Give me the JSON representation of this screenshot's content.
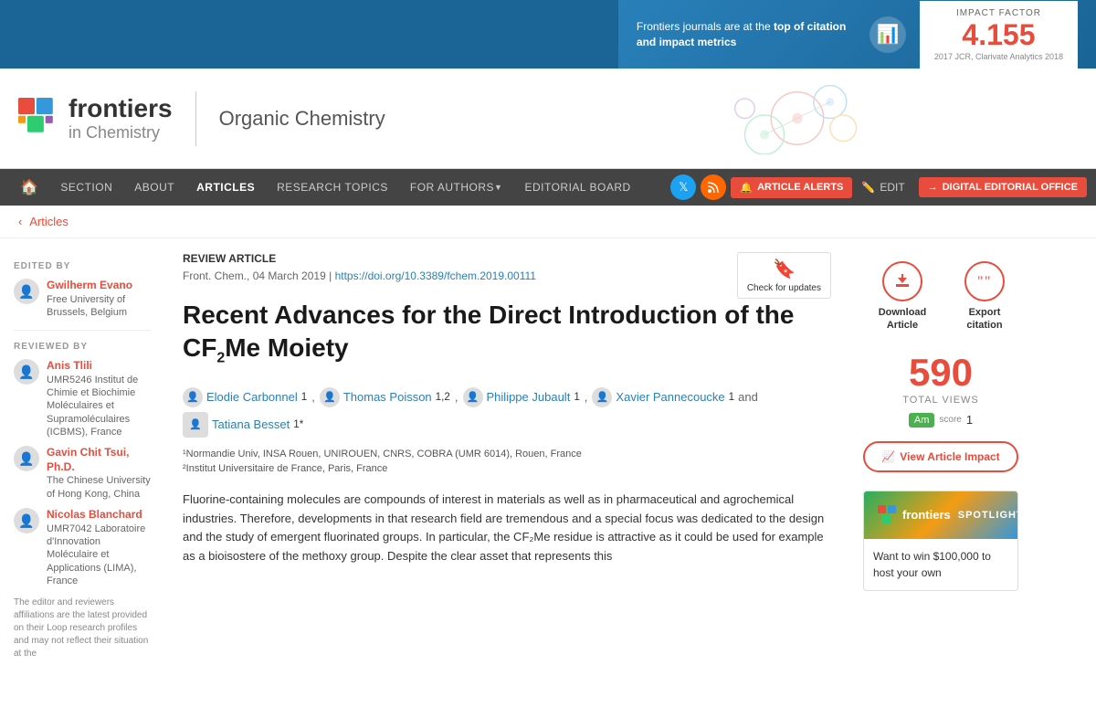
{
  "banner": {
    "text": "Frontiers journals are at the ",
    "text_bold": "top of citation and impact metrics",
    "impact_label": "IMPACT FACTOR",
    "impact_number": "4.155",
    "impact_sub": "2017 JCR, Clarivate Analytics 2018"
  },
  "header": {
    "logo_frontiers": "frontiers",
    "logo_in": "in Chemistry",
    "journal_name": "Organic Chemistry"
  },
  "nav": {
    "items": [
      {
        "label": "SECTION",
        "active": false
      },
      {
        "label": "ABOUT",
        "active": false
      },
      {
        "label": "ARTICLES",
        "active": true
      },
      {
        "label": "RESEARCH TOPICS",
        "active": false
      },
      {
        "label": "FOR AUTHORS",
        "active": false,
        "dropdown": true
      },
      {
        "label": "EDITORIAL BOARD",
        "active": false
      }
    ],
    "alerts_label": "ARTICLE ALERTS",
    "edit_label": "EDIT",
    "digital_label": "DIGITAL EDITORIAL OFFICE"
  },
  "breadcrumb": {
    "back_label": "Articles"
  },
  "left_sidebar": {
    "edited_by_label": "EDITED BY",
    "reviewed_by_label": "REVIEWED BY",
    "editors": [
      {
        "name": "Gwilherm Evano",
        "affiliation": "Free University of Brussels, Belgium"
      }
    ],
    "reviewers": [
      {
        "name": "Anis Tlili",
        "affiliation": "UMR5246 Institut de Chimie et Biochimie Moléculaires et Supramoléculaires (ICBMS), France"
      },
      {
        "name": "Gavin Chit Tsui, Ph.D.",
        "affiliation": "The Chinese University of Hong Kong, China"
      },
      {
        "name": "Nicolas Blanchard",
        "affiliation": "UMR7042 Laboratoire d'Innovation Moléculaire et Applications (LIMA), France"
      }
    ],
    "disclaimer": "The editor and reviewers affiliations are the latest provided on their Loop research profiles and may not reflect their situation at the"
  },
  "article": {
    "type": "REVIEW ARTICLE",
    "journal": "Front. Chem.",
    "date": "04 March 2019",
    "doi": "https://doi.org/10.3389/fchem.2019.00111",
    "doi_text": "https://doi.org/10.3389/fchem.2019.00111",
    "check_updates_label": "Check for updates",
    "title_part1": "Recent Advances for the Direct Introduction of the CF",
    "title_sub": "2",
    "title_part2": "Me Moiety",
    "authors": [
      {
        "name": "Elodie Carbonnel",
        "superscript": "1"
      },
      {
        "name": "Thomas Poisson",
        "superscript": "1,2"
      },
      {
        "name": "Philippe Jubault",
        "superscript": "1"
      },
      {
        "name": "Xavier Pannecoucke",
        "superscript": "1"
      },
      {
        "name": "Tatiana Besset",
        "superscript": "1*"
      }
    ],
    "affiliation1": "¹Normandie Univ, INSA Rouen, UNIROUEN, CNRS, COBRA (UMR 6014), Rouen, France",
    "affiliation2": "²Institut Universitaire de France, Paris, France",
    "abstract": "Fluorine-containing molecules are compounds of interest in materials as well as in pharmaceutical and agrochemical industries. Therefore, developments in that research field are tremendous and a special focus was dedicated to the design and the study of emergent fluorinated groups. In particular, the CF₂Me residue is attractive as it could be used for example as a bioisostere of the methoxy group. Despite the clear asset that represents this"
  },
  "right_sidebar": {
    "download_label": "Download Article",
    "export_label": "Export citation",
    "total_views": "590",
    "total_views_label": "TOTAL VIEWS",
    "altmetric_score": "Am",
    "altmetric_label": "score",
    "altmetric_number": "1",
    "view_impact_label": "View Article Impact",
    "spotlight_header": "frontiers",
    "spotlight_subheader": "SPOTLIGHT",
    "spotlight_text": "Want to win $100,000 to host your own"
  }
}
